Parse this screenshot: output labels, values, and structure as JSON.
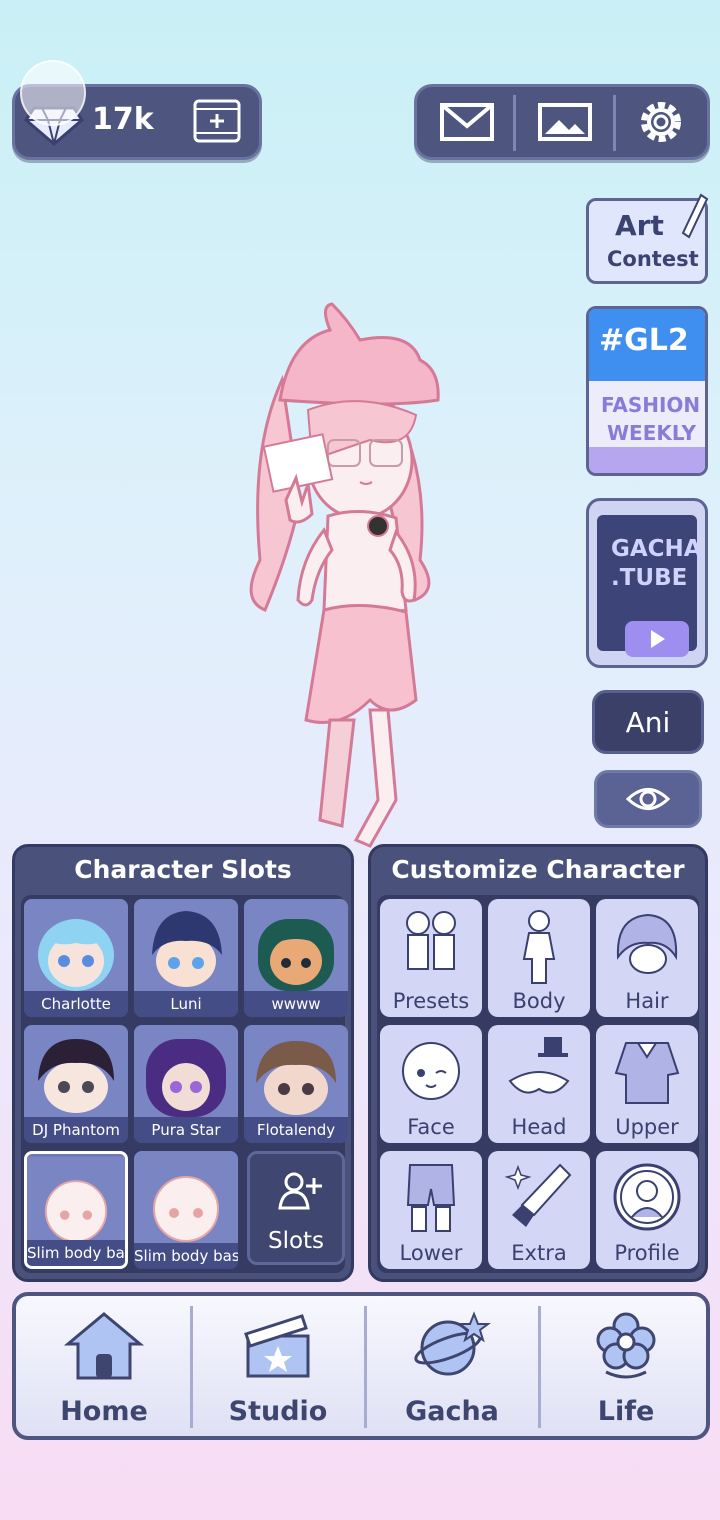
{
  "top_bar": {
    "currency_count": "17k",
    "icons": [
      "gem-icon",
      "film-add-icon",
      "mail-icon",
      "gallery-icon",
      "gear-icon"
    ]
  },
  "side_cards": {
    "art_contest": {
      "line1": "Art",
      "line2": "Contest"
    },
    "fashion_weekly": {
      "tag": "#GL2",
      "line1": "FASHION",
      "line2": "WEEKLY"
    },
    "gacha_tube": {
      "line1": "GACHA",
      "line2": ".TUBE"
    },
    "ani_label": "Ani"
  },
  "character_slots": {
    "title": "Character Slots",
    "slots": [
      {
        "label": "Charlotte",
        "hair": "#8fd3f2",
        "skin": "#f6e4dc",
        "eyes": "#5a8de0"
      },
      {
        "label": "Luni",
        "hair": "#2e3870",
        "skin": "#f8e0d2",
        "eyes": "#5ea3ea"
      },
      {
        "label": "wwww",
        "hair": "#1c5a52",
        "skin": "#e8a976",
        "eyes": "#1f2c3a"
      },
      {
        "label": "DJ Phantom",
        "hair": "#2b2036",
        "skin": "#f6e6de",
        "eyes": "#4a4a56"
      },
      {
        "label": "Pura Star",
        "hair": "#4a2c82",
        "skin": "#f2dcd6",
        "eyes": "#9a66d8"
      },
      {
        "label": "Flotalendy",
        "hair": "#7a5a48",
        "skin": "#f2d8cc",
        "eyes": "#4a3a44"
      },
      {
        "label": "Slim body bas",
        "hair": "#ffffff",
        "skin": "#fbeeee",
        "eyes": "#e6a5a5"
      },
      {
        "label": "Slim body bas",
        "hair": "#ffffff",
        "skin": "#fbeeee",
        "eyes": "#e6a5a5"
      }
    ],
    "slots_button_label": "Slots"
  },
  "customize": {
    "title": "Customize Character",
    "items": [
      {
        "label": "Presets",
        "icon": "presets-icon"
      },
      {
        "label": "Body",
        "icon": "body-icon"
      },
      {
        "label": "Hair",
        "icon": "hair-icon"
      },
      {
        "label": "Face",
        "icon": "face-icon"
      },
      {
        "label": "Head",
        "icon": "head-icon"
      },
      {
        "label": "Upper",
        "icon": "upper-icon"
      },
      {
        "label": "Lower",
        "icon": "lower-icon"
      },
      {
        "label": "Extra",
        "icon": "extra-icon"
      },
      {
        "label": "Profile",
        "icon": "profile-icon"
      }
    ]
  },
  "bottom_nav": {
    "items": [
      {
        "label": "Home",
        "icon": "house-icon"
      },
      {
        "label": "Studio",
        "icon": "clapperboard-icon"
      },
      {
        "label": "Gacha",
        "icon": "planet-icon"
      },
      {
        "label": "Life",
        "icon": "flower-icon"
      }
    ]
  },
  "colors": {
    "panel": "#4a527c",
    "panel_dark": "#353b63",
    "accent": "#9d8ef0",
    "character_pink": "#f2a9c0"
  }
}
